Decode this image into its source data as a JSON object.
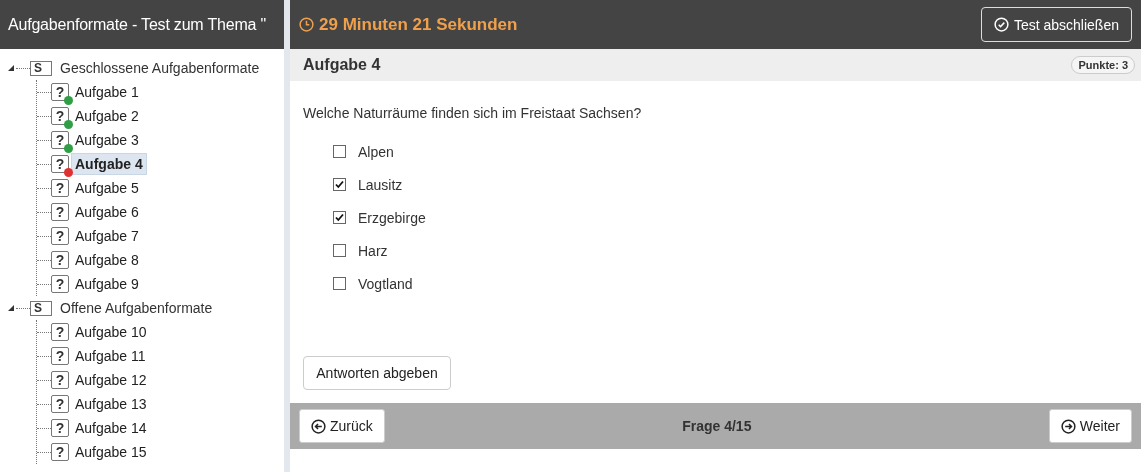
{
  "sidebar": {
    "title": "Aufgabenformate - Test zum Thema \"",
    "tree": [
      {
        "label": "Geschlossene Aufgabenformate",
        "marker": "S",
        "expanded": true,
        "children": [
          {
            "label": "Aufgabe 1",
            "marker": "?",
            "selected": false,
            "color": "#2f9e44"
          },
          {
            "label": "Aufgabe 2",
            "marker": "?",
            "selected": false,
            "color": "#2f9e44"
          },
          {
            "label": "Aufgabe 3",
            "marker": "?",
            "selected": false,
            "color": "#2f9e44"
          },
          {
            "label": "Aufgabe 4",
            "marker": "?",
            "selected": true,
            "color": "#e03131"
          },
          {
            "label": "Aufgabe 5",
            "marker": "?",
            "selected": false
          },
          {
            "label": "Aufgabe 6",
            "marker": "?",
            "selected": false
          },
          {
            "label": "Aufgabe 7",
            "marker": "?",
            "selected": false
          },
          {
            "label": "Aufgabe 8",
            "marker": "?",
            "selected": false
          },
          {
            "label": "Aufgabe 9",
            "marker": "?",
            "selected": false
          }
        ]
      },
      {
        "label": "Offene Aufgabenformate",
        "marker": "S",
        "expanded": true,
        "children": [
          {
            "label": "Aufgabe 10",
            "marker": "?",
            "selected": false
          },
          {
            "label": "Aufgabe 11",
            "marker": "?",
            "selected": false
          },
          {
            "label": "Aufgabe 12",
            "marker": "?",
            "selected": false
          },
          {
            "label": "Aufgabe 13",
            "marker": "?",
            "selected": false
          },
          {
            "label": "Aufgabe 14",
            "marker": "?",
            "selected": false
          },
          {
            "label": "Aufgabe 15",
            "marker": "?",
            "selected": false
          }
        ]
      }
    ]
  },
  "header": {
    "timer": "29 Minuten 21 Sekunden",
    "finish_button": "Test abschließen"
  },
  "task": {
    "title": "Aufgabe 4",
    "points": "Punkte: 3",
    "question": "Welche Naturräume finden sich im Freistaat Sachsen?",
    "options": [
      {
        "label": "Alpen",
        "checked": false
      },
      {
        "label": "Lausitz",
        "checked": true
      },
      {
        "label": "Erzgebirge",
        "checked": true
      },
      {
        "label": "Harz",
        "checked": false
      },
      {
        "label": "Vogtland",
        "checked": false
      }
    ],
    "submit_button": "Antworten abgeben"
  },
  "footer": {
    "back_button": "Zurück",
    "progress": "Frage 4/15",
    "next_button": "Weiter"
  }
}
